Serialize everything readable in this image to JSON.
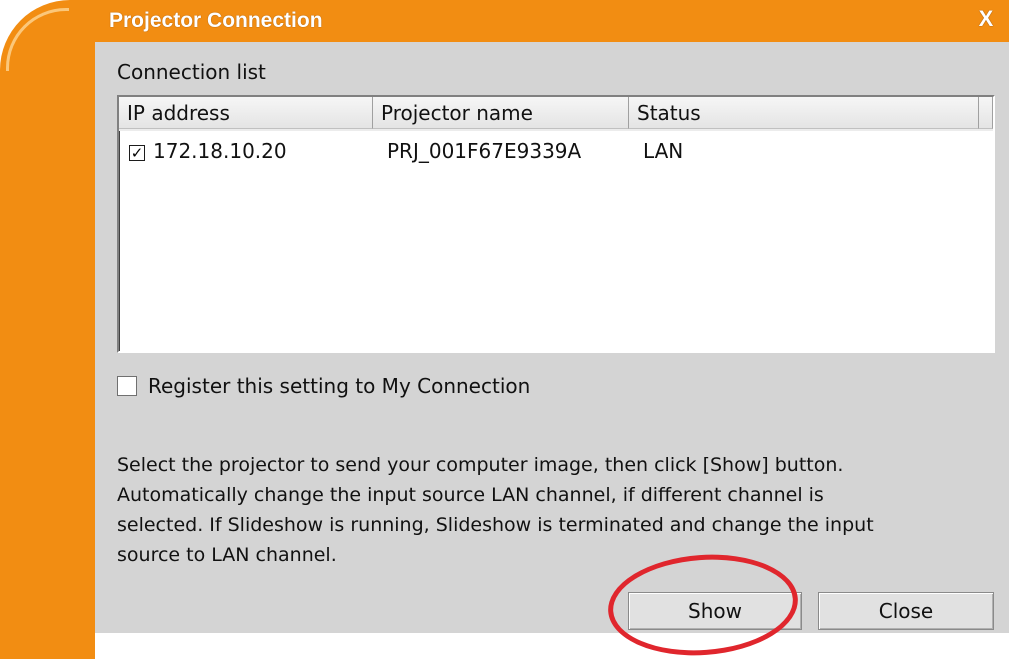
{
  "window": {
    "title": "Projector Connection",
    "close_glyph": "X"
  },
  "connection_list": {
    "label": "Connection list",
    "columns": [
      "IP address",
      "Projector name",
      "Status"
    ],
    "rows": [
      {
        "checked": true,
        "ip": "172.18.10.20",
        "name": "PRJ_001F67E9339A",
        "status": "LAN"
      }
    ]
  },
  "register": {
    "checked": false,
    "label": "Register this setting to My Connection"
  },
  "description": [
    "Select the projector to send your computer image, then click [Show] button.",
    "Automatically change the input source LAN channel, if different channel is",
    "selected. If Slideshow is running, Slideshow is terminated and change the input",
    "source to LAN channel."
  ],
  "buttons": {
    "show": "Show",
    "close": "Close"
  },
  "colors": {
    "title_bar": "#f28d12",
    "dialog_bg": "#d4d4d4",
    "highlight_circle": "#e0262d"
  },
  "icons": {
    "row_checkbox": "checkbox-checked-icon",
    "register_checkbox": "checkbox-unchecked-icon",
    "close": "close-icon"
  }
}
